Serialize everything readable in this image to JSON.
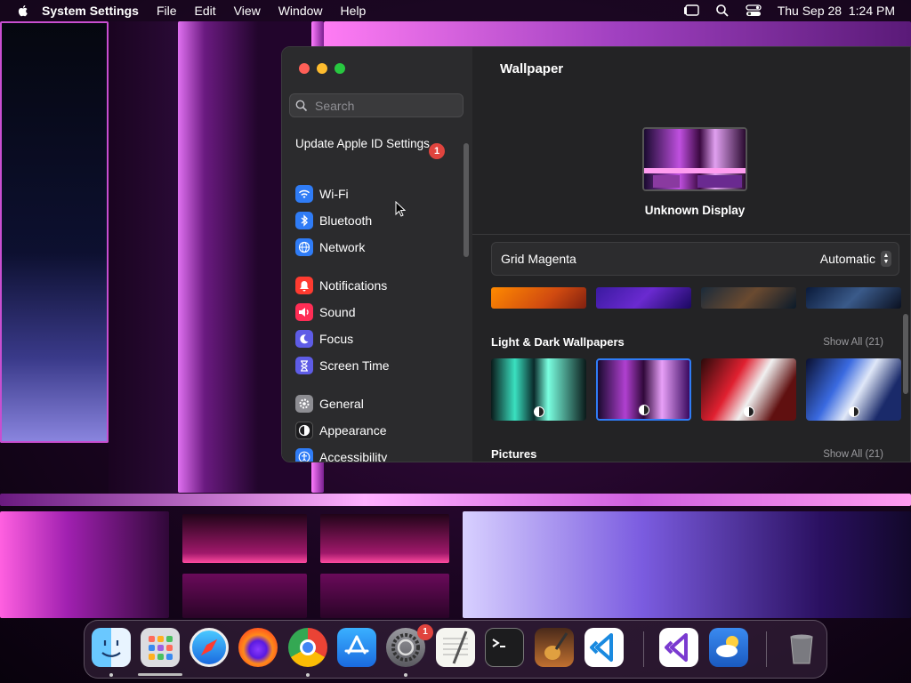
{
  "menubar": {
    "app_name": "System Settings",
    "menus": [
      "File",
      "Edit",
      "View",
      "Window",
      "Help"
    ],
    "datetime": "Thu Sep 28  1:24 PM"
  },
  "sidebar": {
    "search_placeholder": "Search",
    "apple_id": {
      "label": "Update Apple ID Settings",
      "badge": "1"
    },
    "groups": [
      [
        {
          "label": "Wi-Fi",
          "icon": "wifi-icon",
          "color": "#2f7cf6"
        },
        {
          "label": "Bluetooth",
          "icon": "bluetooth-icon",
          "color": "#2f7cf6"
        },
        {
          "label": "Network",
          "icon": "globe-icon",
          "color": "#2f7cf6"
        }
      ],
      [
        {
          "label": "Notifications",
          "icon": "bell-icon",
          "color": "#ff3b30"
        },
        {
          "label": "Sound",
          "icon": "speaker-icon",
          "color": "#ff2d55"
        },
        {
          "label": "Focus",
          "icon": "moon-icon",
          "color": "#5e5ce6"
        },
        {
          "label": "Screen Time",
          "icon": "hourglass-icon",
          "color": "#5e5ce6"
        }
      ],
      [
        {
          "label": "General",
          "icon": "gear-icon",
          "color": "#8e8e93"
        },
        {
          "label": "Appearance",
          "icon": "appearance-icon",
          "color": "#1c1c1e"
        },
        {
          "label": "Accessibility",
          "icon": "accessibility-icon",
          "color": "#2f7cf6"
        }
      ]
    ]
  },
  "content": {
    "title": "Wallpaper",
    "display_name": "Unknown Display",
    "wallpaper_name": "Grid Magenta",
    "mode": "Automatic",
    "sections": [
      {
        "title": "Light & Dark Wallpapers",
        "show_all": "Show All (21)"
      },
      {
        "title": "Pictures",
        "show_all": "Show All (21)"
      }
    ]
  },
  "dock": {
    "apps": [
      "Finder",
      "Launchpad",
      "Safari",
      "Firefox",
      "Chrome",
      "App Store",
      "System Settings",
      "TextEdit",
      "Terminal",
      "GarageBand",
      "Visual Studio Code",
      "Visual Studio",
      "Weather",
      "Trash"
    ],
    "settings_badge": "1"
  }
}
